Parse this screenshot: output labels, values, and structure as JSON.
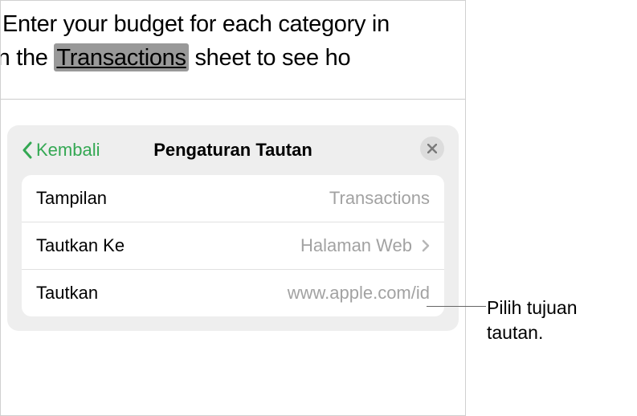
{
  "document": {
    "line1": "Enter your budget for each category in",
    "line2_prefix": "ns on the ",
    "link_text": "Transactions",
    "line2_suffix": " sheet to see ho"
  },
  "popover": {
    "back_label": "Kembali",
    "title": "Pengaturan Tautan",
    "rows": {
      "display": {
        "label": "Tampilan",
        "value": "Transactions"
      },
      "link_to": {
        "label": "Tautkan Ke",
        "value": "Halaman Web"
      },
      "link_url": {
        "label": "Tautkan",
        "value": "www.apple.com/id"
      }
    }
  },
  "callout": {
    "line1": "Pilih tujuan",
    "line2": "tautan."
  }
}
